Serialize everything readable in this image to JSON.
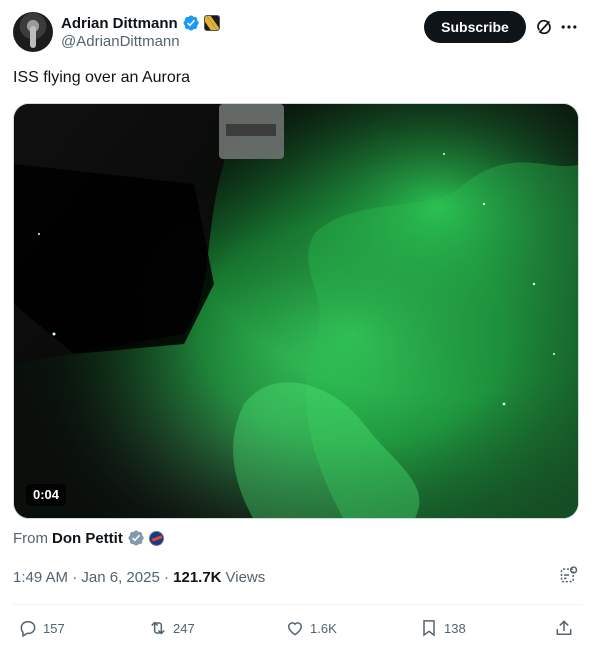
{
  "author": {
    "display_name": "Adrian Dittmann",
    "handle": "@AdrianDittmann",
    "subscribe_label": "Subscribe"
  },
  "icons": {
    "verified": "verified-badge-icon",
    "affiliate": "affiliate-badge-icon",
    "grok": "grok-icon",
    "more": "more-icon",
    "analytics": "analytics-icon"
  },
  "tweet": {
    "text": "ISS flying over an Aurora"
  },
  "media": {
    "video_time": "0:04",
    "accent": "#2fd45a"
  },
  "attribution": {
    "from_label": "From",
    "from_name": "Don Pettit"
  },
  "meta": {
    "time": "1:49 AM",
    "separator": " · ",
    "date": "Jan 6, 2025",
    "separator2": " · ",
    "views_count": "121.7K",
    "views_label": "Views"
  },
  "actions": {
    "replies": "157",
    "reposts": "247",
    "likes": "1.6K",
    "bookmarks": "138"
  },
  "colors": {
    "text_primary": "#0f1419",
    "text_secondary": "#536471",
    "verified_blue": "#1d9bf0",
    "button_dark": "#0f1419"
  }
}
